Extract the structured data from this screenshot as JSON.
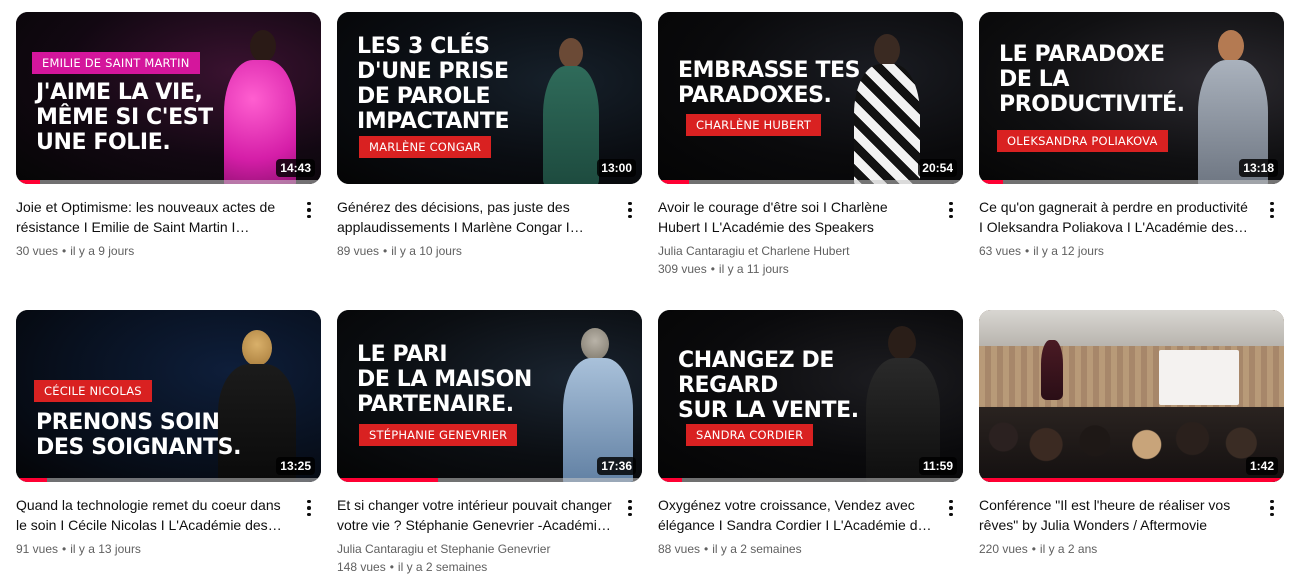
{
  "videos": [
    {
      "title": "Joie et Optimisme: les nouveaux actes de résistance I Emilie de Saint Martin I L'Académie des Speakers",
      "views": "30 vues",
      "date": "il y a 9 jours",
      "duration": "14:43",
      "channel": "",
      "watched": 0.08,
      "thumb": {
        "text": "J'AIME LA VIE,\nMÊME SI C'EST\nUNE FOLIE.",
        "name": "EMILIE DE SAINT MARTIN",
        "name_color": "pink"
      }
    },
    {
      "title": "Générez des décisions, pas juste des applaudissements I Marlène Congar I L'Académie des Speakers",
      "views": "89 vues",
      "date": "il y a 10 jours",
      "duration": "13:00",
      "channel": "",
      "watched": 0,
      "thumb": {
        "text": "LES 3 CLÉS\nD'UNE PRISE\nDE PAROLE\nIMPACTANTE",
        "name": "MARLÈNE CONGAR",
        "name_color": "red"
      }
    },
    {
      "title": "Avoir le courage d'être soi I Charlène Hubert I L'Académie des Speakers",
      "views": "309 vues",
      "date": "il y a 11 jours",
      "duration": "20:54",
      "channel": "Julia Cantaragiu et Charlene Hubert",
      "watched": 0.1,
      "thumb": {
        "text": "EMBRASSE TES\nPARADOXES.",
        "name": "CHARLÈNE HUBERT",
        "name_color": "red"
      }
    },
    {
      "title": "Ce qu'on gagnerait à perdre en productivité I Oleksandra Poliakova I L'Académie des Speakers",
      "views": "63 vues",
      "date": "il y a 12 jours",
      "duration": "13:18",
      "channel": "",
      "watched": 0.08,
      "thumb": {
        "text": "LE PARADOXE\nDE LA\nPRODUCTIVITÉ.",
        "name": "OLEKSANDRA POLIAKOVA",
        "name_color": "red"
      }
    },
    {
      "title": "Quand la technologie remet du coeur dans le soin I Cécile Nicolas I L'Académie des Speakers",
      "views": "91 vues",
      "date": "il y a 13 jours",
      "duration": "13:25",
      "channel": "",
      "watched": 0.1,
      "thumb": {
        "text": "PRENONS SOIN\nDES SOIGNANTS.",
        "name": "CÉCILE NICOLAS",
        "name_color": "red"
      }
    },
    {
      "title": "Et si changer votre intérieur pouvait changer votre vie ? Stéphanie Genevrier -Académie des Speakers",
      "views": "148 vues",
      "date": "il y a 2 semaines",
      "duration": "17:36",
      "channel": "Julia Cantaragiu et Stephanie Genevrier",
      "watched": 0.33,
      "thumb": {
        "text": "LE PARI\nDE LA MAISON\nPARTENAIRE.",
        "name": "STÉPHANIE GENEVRIER",
        "name_color": "red"
      }
    },
    {
      "title": "Oxygénez votre croissance, Vendez avec élégance I Sandra Cordier I L'Académie des Speakers",
      "views": "88 vues",
      "date": "il y a 2 semaines",
      "duration": "11:59",
      "channel": "",
      "watched": 0.08,
      "thumb": {
        "text": "CHANGEZ DE\nREGARD\nSUR LA VENTE.",
        "name": "SANDRA CORDIER",
        "name_color": "red"
      }
    },
    {
      "title": "Conférence \"Il est l'heure de réaliser vos rêves\" by Julia Wonders / Aftermovie",
      "views": "220 vues",
      "date": "il y a 2 ans",
      "duration": "1:42",
      "channel": "",
      "watched": 1.0,
      "thumb": {
        "text": "",
        "name": "",
        "name_color": ""
      }
    }
  ],
  "separator": "•",
  "colors": {
    "progress": "#ff0033",
    "pink_label": "#d4169c",
    "red_label": "#d92121"
  },
  "icons": {
    "menu": "more-vert-icon"
  }
}
